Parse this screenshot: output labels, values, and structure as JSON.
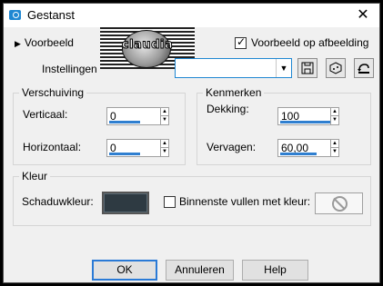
{
  "window": {
    "title": "Gestanst",
    "close_glyph": "✕"
  },
  "preview": {
    "toggle_label": "Voorbeeld",
    "logo_text": "claudia",
    "on_image_label": "Voorbeeld op afbeelding",
    "on_image_checked": true
  },
  "settings": {
    "label": "Instellingen",
    "value": "",
    "icons": [
      "save-icon",
      "dice-icon",
      "reset-icon"
    ]
  },
  "offset": {
    "title": "Verschuiving",
    "vertical_label": "Verticaal:",
    "vertical_value": "0",
    "horizontal_label": "Horizontaal:",
    "horizontal_value": "0"
  },
  "properties": {
    "title": "Kenmerken",
    "opacity_label": "Dekking:",
    "opacity_value": "100",
    "blur_label": "Vervagen:",
    "blur_value": "60,00"
  },
  "color": {
    "title": "Kleur",
    "shadow_label": "Schaduwkleur:",
    "shadow_color": "#2e3a42",
    "fill_inner_label": "Binnenste vullen met kleur:",
    "fill_inner_checked": false
  },
  "buttons": {
    "ok": "OK",
    "cancel": "Annuleren",
    "help": "Help"
  }
}
